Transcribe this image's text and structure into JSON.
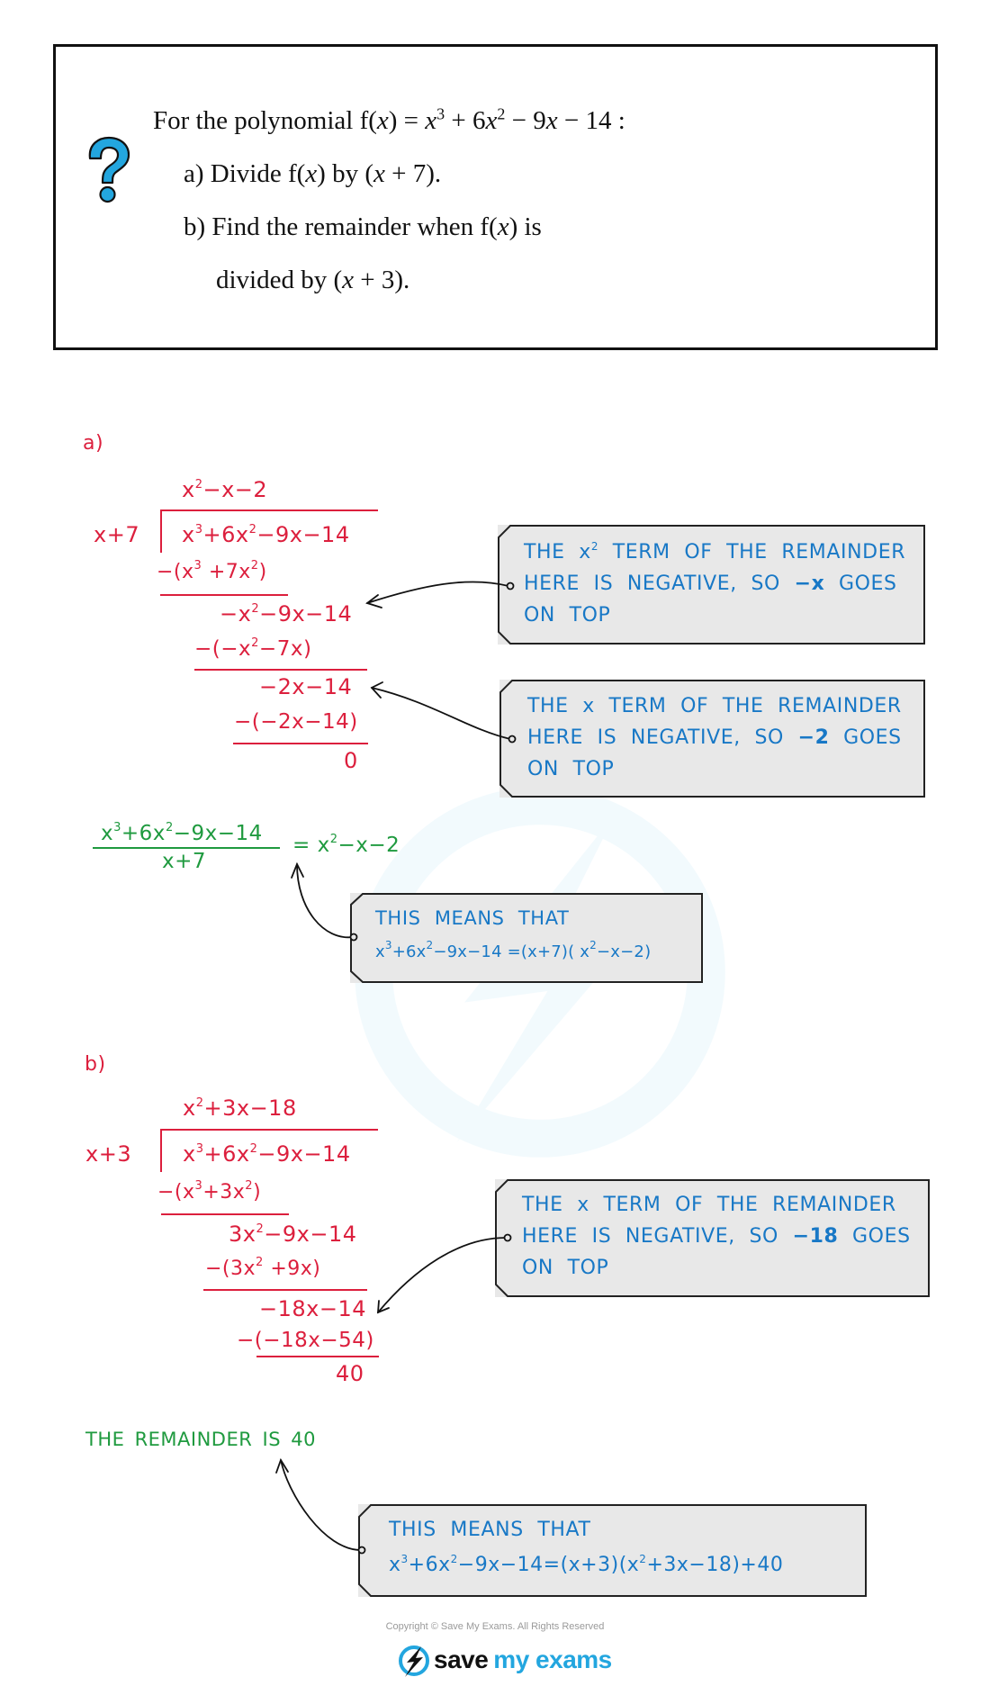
{
  "question": {
    "icon": "question-mark-icon",
    "intro": "For the polynomial f(x) = x³ + 6x² − 9x − 14 :",
    "intro_parts": {
      "lead": "For the polynomial f(",
      "x": "x",
      "mid": ") = ",
      "poly_x3": "x",
      "sup3": "3",
      "poly_mid1": " + 6",
      "poly_x2": "x",
      "sup2": "2",
      "poly_mid2": " − 9",
      "poly_x": "x",
      "poly_end": " − 14 :"
    },
    "part_a": "a) Divide f(x) by (x + 7).",
    "part_a_parts": {
      "lead": "a) Divide f(",
      "x1": "x",
      "mid": ") by (",
      "x2": "x",
      "end": " + 7)."
    },
    "part_b_line1": "b) Find the remainder when f(x) is",
    "part_b_line1_parts": {
      "lead": "b) Find the remainder when f(",
      "x": "x",
      "end": ") is"
    },
    "part_b_line2": "divided by (x + 3).",
    "part_b_line2_parts": {
      "lead": "divided by (",
      "x": "x",
      "end": " + 3)."
    }
  },
  "part_a": {
    "label": "a)",
    "divisor": "x+7",
    "quotient": {
      "pre": "x",
      "sup": "2",
      "post": "−x−2"
    },
    "dividend": {
      "a": "x",
      "s1": "3",
      "b": "+6x",
      "s2": "2",
      "c": "−9x−14"
    },
    "steps": [
      {
        "kind": "subtract",
        "a": "−(x",
        "s1": "3",
        "b": " +7x",
        "s2": "2",
        "c": ")"
      },
      {
        "kind": "remainder",
        "a": "−x",
        "s1": "2",
        "b": "−9x−14"
      },
      {
        "kind": "subtract",
        "a": "−(−x",
        "s1": "2",
        "b": "−7x)"
      },
      {
        "kind": "remainder",
        "text": "−2x−14"
      },
      {
        "kind": "subtract",
        "text": "−(−2x−14)"
      },
      {
        "kind": "remainder",
        "text": "0"
      }
    ],
    "result": {
      "numerator": {
        "a": "x",
        "s1": "3",
        "b": "+6x",
        "s2": "2",
        "c": "−9x−14"
      },
      "denominator": "x+7",
      "equals": {
        "pre": "= x",
        "sup": "2",
        "post": "−x−2"
      }
    },
    "callouts": [
      {
        "l1_a": "THE x",
        "l1_sup": "2",
        "l1_b": " TERM  OF  THE  REMAINDER",
        "l2_a": "HERE  IS  NEGATIVE,  SO ",
        "l2_bold": "−x",
        "l2_b": "  GOES",
        "l3": "ON  TOP"
      },
      {
        "l1_a": "THE  x  TERM  OF  THE  REMAINDER",
        "l1_sup": "",
        "l1_b": "",
        "l2_a": "HERE  IS  NEGATIVE,  SO ",
        "l2_bold": "−2",
        "l2_b": "  GOES",
        "l3": "ON  TOP"
      }
    ],
    "means_callout": {
      "heading": "THIS  MEANS  THAT",
      "eq": {
        "a": "x",
        "s1": "3",
        "b": "+6x",
        "s2": "2",
        "c": "−9x−14 =(x+7)( x",
        "s3": "2",
        "d": "−x−2)"
      }
    }
  },
  "part_b": {
    "label": "b)",
    "divisor": "x+3",
    "quotient": {
      "pre": "x",
      "sup": "2",
      "post": "+3x−18"
    },
    "dividend": {
      "a": "x",
      "s1": "3",
      "b": "+6x",
      "s2": "2",
      "c": "−9x−14"
    },
    "steps": [
      {
        "kind": "subtract",
        "a": "−(x",
        "s1": "3",
        "b": "+3x",
        "s2": "2",
        "c": ")"
      },
      {
        "kind": "remainder",
        "a": "3x",
        "s1": "2",
        "b": "−9x−14"
      },
      {
        "kind": "subtract",
        "a": "−(3x",
        "s1": "2",
        "b": " +9x)"
      },
      {
        "kind": "remainder",
        "text": "−18x−14"
      },
      {
        "kind": "subtract",
        "text": "−(−18x−54)"
      },
      {
        "kind": "remainder",
        "text": "40"
      }
    ],
    "conclusion": "THE  REMAINDER  IS  40",
    "callout": {
      "l1_a": "THE  x  TERM  OF  THE  REMAINDER",
      "l2_a": "HERE  IS  NEGATIVE,  SO ",
      "l2_bold": "−18",
      "l2_b": " GOES",
      "l3": "ON  TOP"
    },
    "means_callout": {
      "heading": "THIS  MEANS  THAT",
      "eq": {
        "a": "x",
        "s1": "3",
        "b": "+6x",
        "s2": "2",
        "c": "−9x−14=(x+3)(x",
        "s3": "2",
        "d": "+3x−18)+40"
      }
    }
  },
  "footer": {
    "copyright": "Copyright © Save My Exams. All Rights Reserved",
    "brand_part1": "save",
    "brand_part2": "my exams"
  },
  "colors": {
    "working_red": "#dc1f3d",
    "result_green": "#1f9a3f",
    "note_blue": "#1878c6",
    "callout_gray": "#e8e8e8",
    "brand_cyan": "#23a6df"
  }
}
